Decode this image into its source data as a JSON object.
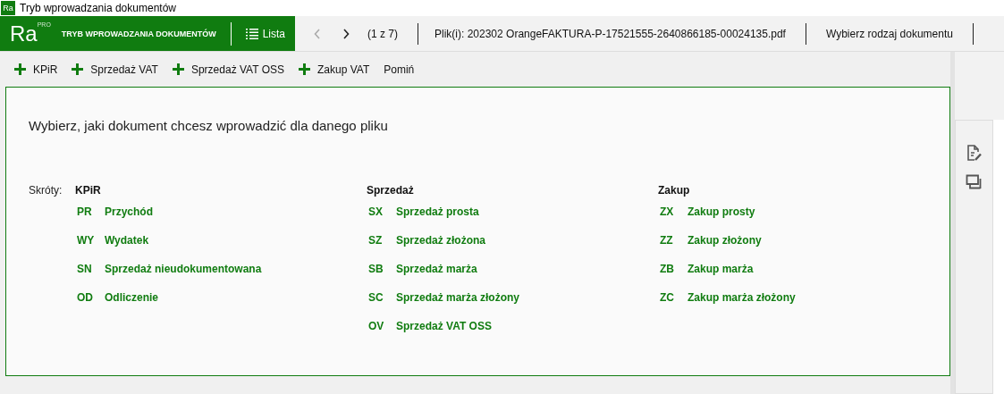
{
  "window": {
    "icon_text": "Ra",
    "title": "Tryb wprowadzania dokumentów"
  },
  "header": {
    "logo": "Ra",
    "logo_badge": "PRO",
    "mode_title": "TRYB WPROWADZANIA DOKUMENTÓW",
    "list_button": "Lista",
    "prev_disabled": true,
    "next_disabled": false,
    "page": "(1 z 7)",
    "file": "Plik(i): 202302 OrangeFAKTURA-P-17521555-2640866185-00024135.pdf",
    "doc_type_button": "Wybierz rodzaj dokumentu"
  },
  "toolbar": [
    {
      "label": "KPiR",
      "kind": "add"
    },
    {
      "label": "Sprzedaż VAT",
      "kind": "add"
    },
    {
      "label": "Sprzedaż VAT OSS",
      "kind": "add"
    },
    {
      "label": "Zakup VAT",
      "kind": "add"
    },
    {
      "label": "Pomiń",
      "kind": "plain"
    }
  ],
  "prompt": "Wybierz, jaki dokument chcesz wprowadzić dla danego pliku",
  "shortcuts_label": "Skróty:",
  "groups": [
    {
      "title": "KPiR",
      "items": [
        {
          "code": "PR",
          "name": "Przychód"
        },
        {
          "code": "WY",
          "name": "Wydatek"
        },
        {
          "code": "SN",
          "name": "Sprzedaż nieudokumentowana"
        },
        {
          "code": "OD",
          "name": "Odliczenie"
        }
      ]
    },
    {
      "title": "Sprzedaż",
      "items": [
        {
          "code": "SX",
          "name": "Sprzedaż prosta"
        },
        {
          "code": "SZ",
          "name": "Sprzedaż złożona"
        },
        {
          "code": "SB",
          "name": "Sprzedaż marża"
        },
        {
          "code": "SC",
          "name": "Sprzedaż marża złożony"
        },
        {
          "code": "OV",
          "name": "Sprzedaż VAT OSS"
        }
      ]
    },
    {
      "title": "Zakup",
      "items": [
        {
          "code": "ZX",
          "name": "Zakup prosty"
        },
        {
          "code": "ZZ",
          "name": "Zakup złożony"
        },
        {
          "code": "ZB",
          "name": "Zakup marża"
        },
        {
          "code": "ZC",
          "name": "Zakup marża złożony"
        }
      ]
    }
  ]
}
